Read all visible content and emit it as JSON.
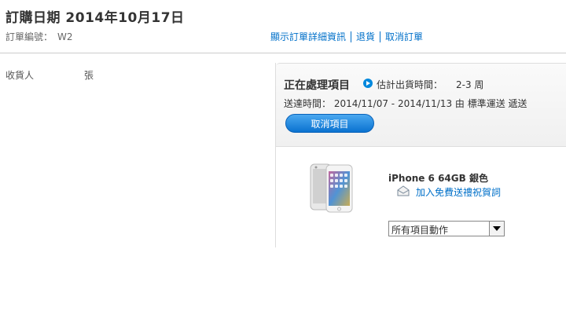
{
  "order": {
    "title": "訂購日期 2014年10月17日",
    "number_label": "訂單編號：",
    "number_value": "W2",
    "links": {
      "details": "顯示訂單詳細資訊",
      "return": "退貨",
      "cancel": "取消訂單"
    }
  },
  "recipient": {
    "label": "收貨人",
    "value": "張"
  },
  "shipment": {
    "status_title": "正在處理項目",
    "estimate_label": "估計出貨時間：",
    "estimate_value": "2-3 周",
    "delivery_text": "送達時間： 2014/11/07 - 2014/11/13 由 標準運送 遞送",
    "cancel_item_label": "取消項目"
  },
  "item": {
    "name": "iPhone 6 64GB 銀色",
    "gift_link": "加入免費送禮祝賀詞",
    "action_select_value": "所有項目動作"
  },
  "colors": {
    "link": "#0070c9",
    "button": "#0a72d0"
  }
}
